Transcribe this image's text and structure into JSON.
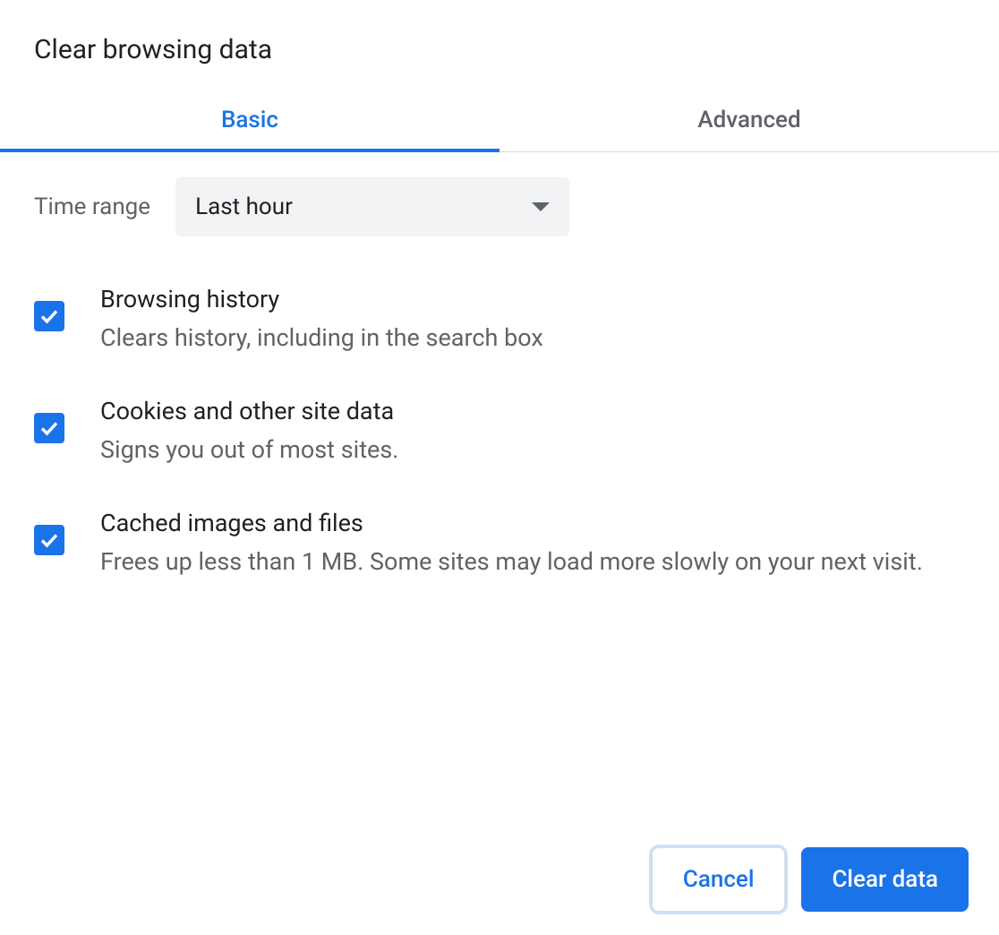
{
  "dialog": {
    "title": "Clear browsing data",
    "tabs": {
      "basic": "Basic",
      "advanced": "Advanced"
    },
    "time": {
      "label": "Time range",
      "value": "Last hour"
    },
    "options": [
      {
        "title": "Browsing history",
        "desc": "Clears history, including in the search box",
        "checked": true
      },
      {
        "title": "Cookies and other site data",
        "desc": "Signs you out of most sites.",
        "checked": true
      },
      {
        "title": "Cached images and files",
        "desc": "Frees up less than 1 MB. Some sites may load more slowly on your next visit.",
        "checked": true
      }
    ],
    "buttons": {
      "cancel": "Cancel",
      "clear": "Clear data"
    }
  }
}
